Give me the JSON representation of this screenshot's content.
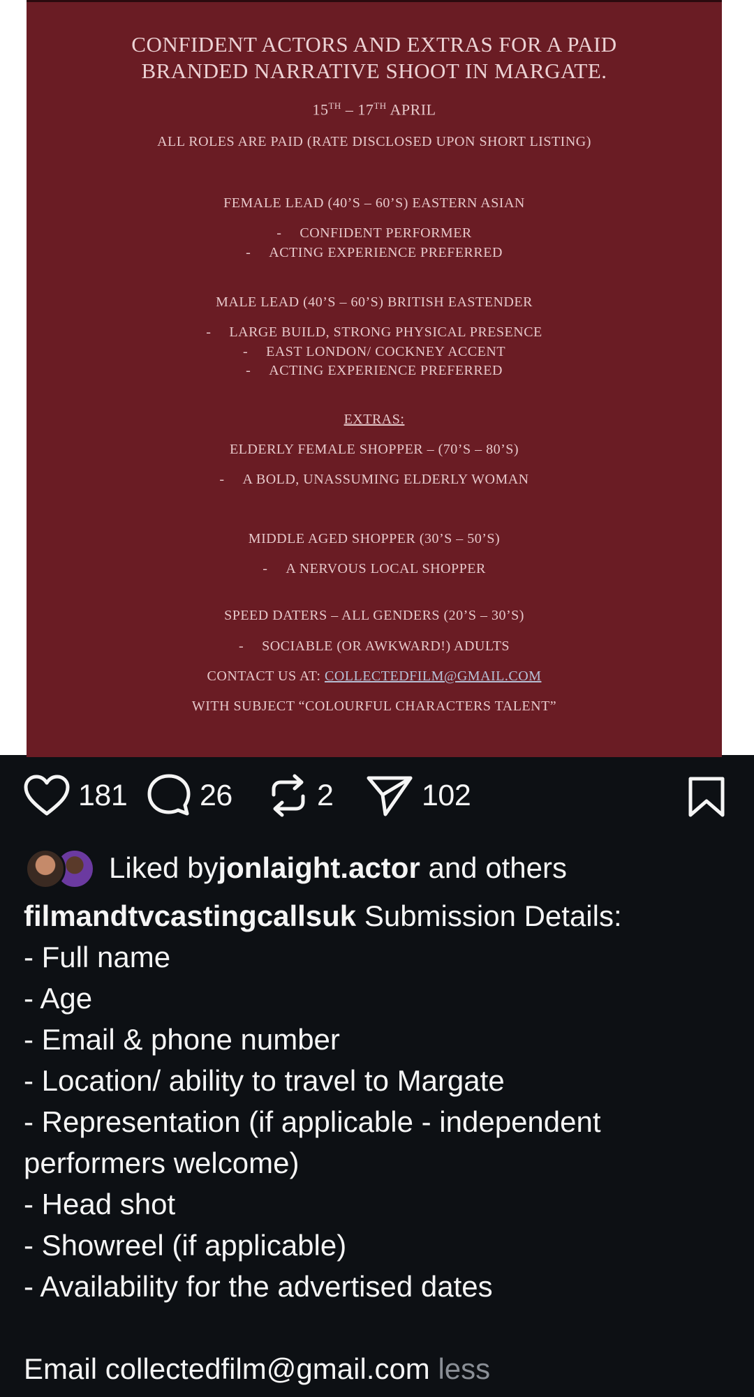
{
  "poster": {
    "title_line1": "CONFIDENT ACTORS AND EXTRAS FOR A PAID",
    "title_line2": "BRANDED NARRATIVE SHOOT IN MARGATE.",
    "date_start_num": "15",
    "date_sup1": "TH",
    "date_mid": " – 17",
    "date_sup2": "TH",
    "date_end": " APRIL",
    "paid_note": "ALL ROLES ARE PAID (RATE DISCLOSED UPON SHORT LISTING)",
    "role1_title": "FEMALE LEAD (40’S – 60’S) EASTERN ASIAN",
    "role1_b1": "CONFIDENT PERFORMER",
    "role1_b2": "ACTING EXPERIENCE PREFERRED",
    "role2_title": "MALE LEAD (40’S – 60’S) BRITISH EASTENDER",
    "role2_b1": "LARGE BUILD, STRONG PHYSICAL PRESENCE",
    "role2_b2": "EAST LONDON/ COCKNEY ACCENT",
    "role2_b3": "ACTING EXPERIENCE PREFERRED",
    "extras_heading": "EXTRAS:",
    "extra1_title": "ELDERLY FEMALE SHOPPER – (70’S – 80’S)",
    "extra1_b1": "A BOLD, UNASSUMING ELDERLY WOMAN",
    "extra2_title": "MIDDLE AGED SHOPPER (30’S – 50’S)",
    "extra2_b1": "A NERVOUS LOCAL SHOPPER",
    "extra3_title": "SPEED DATERS – ALL GENDERS (20’S – 30’S)",
    "extra3_b1": "SOCIABLE (OR AWKWARD!) ADULTS",
    "contact_prefix": "CONTACT US AT: ",
    "contact_email": "COLLECTEDFILM@GMAIL.COM",
    "subject_line": "WITH SUBJECT “COLOURFUL CHARACTERS TALENT”",
    "dash": "-"
  },
  "actions": {
    "likes": "181",
    "comments": "26",
    "reposts": "2",
    "shares": "102"
  },
  "liked_by": {
    "prefix": "Liked by ",
    "user": "jonlaight.actor",
    "suffix": " and others"
  },
  "caption": {
    "username": "filmandtvcastingcallsuk",
    "first_line_text": " Submission Details:",
    "lines": [
      "- Full name",
      "- Age",
      "- Email & phone number",
      "- Location/ ability to travel to Margate",
      "- Representation (if applicable - independent",
      "performers welcome)",
      "- Head shot",
      "- Showreel (if applicable)",
      "- Availability for the advertised dates"
    ],
    "email_line": "Email collectedfilm@gmail.com ",
    "less_label": "less"
  },
  "icons": {
    "like": "heart-icon",
    "comment": "comment-bubble-icon",
    "repost": "repost-icon",
    "share": "send-icon",
    "save": "bookmark-icon"
  },
  "colors": {
    "background": "#0d1014",
    "poster": "#6a1c24",
    "poster_text": "#e7c9cb"
  }
}
